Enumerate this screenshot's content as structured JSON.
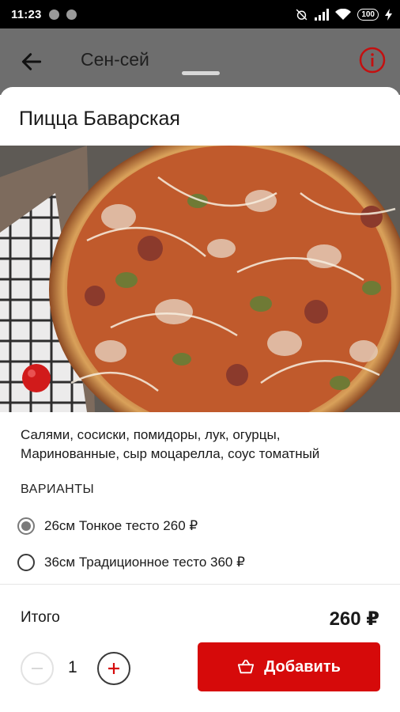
{
  "status_bar": {
    "time": "11:23",
    "battery": "100"
  },
  "app_bar": {
    "title": "Сен-сей"
  },
  "product": {
    "title": "Пицца Баварская",
    "description_line1": "Салями, сосиски, помидоры, лук, огурцы,",
    "description_line2": "Маринованные, сыр моцарелла,  соус томатный"
  },
  "variants": {
    "heading": "ВАРИАНТЫ",
    "options": [
      {
        "label": "26см Тонкое тесто  260 ₽",
        "selected": true
      },
      {
        "label": "36см Традиционное тесто  360 ₽",
        "selected": false
      }
    ]
  },
  "summary": {
    "total_label": "Итого",
    "total_price": "260 ₽",
    "quantity": "1",
    "add_label": "Добавить"
  },
  "colors": {
    "accent": "#d60a0a",
    "info_icon": "#c41010",
    "appbar_dimmed": "#6e6e6e"
  },
  "icons": {
    "back": "arrow-left-icon",
    "info": "info-circle-icon",
    "minus": "minus-icon",
    "plus": "plus-icon",
    "basket": "basket-icon"
  }
}
